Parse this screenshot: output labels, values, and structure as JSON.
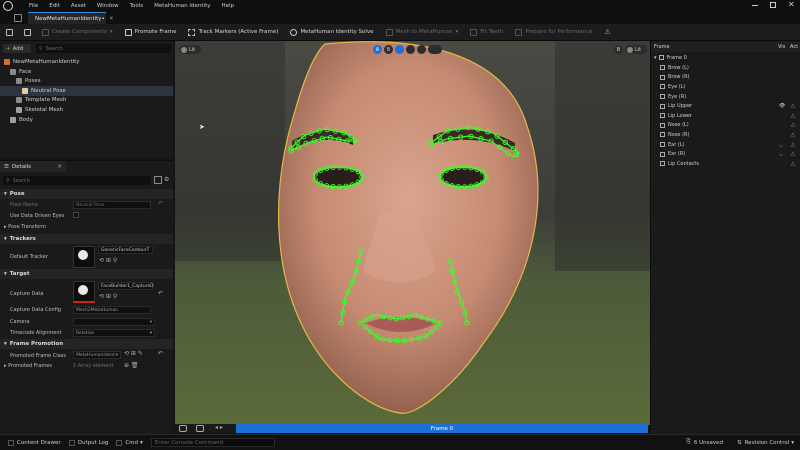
{
  "menu": [
    "File",
    "Edit",
    "Asset",
    "Window",
    "Tools",
    "MetaHuman Identity",
    "Help"
  ],
  "tab": {
    "label": "NewMetaHumanIdentity•"
  },
  "toolbar": {
    "create_components": "Create Components",
    "promote_frame": "Promote Frame",
    "track_markers": "Track Markers (Active Frame)",
    "identity_solve": "MetaHuman Identity Solve",
    "mesh_to_metahuman": "Mesh to MetaHuman",
    "fit_teeth": "Fit Teeth",
    "prepare_for_performance": "Prepare for Performance"
  },
  "outliner": {
    "add_label": "Add",
    "search_placeholder": "Search",
    "items": [
      {
        "label": "NewMetaHumanIdentity",
        "depth": 0
      },
      {
        "label": "Face",
        "depth": 1
      },
      {
        "label": "Poses",
        "depth": 2
      },
      {
        "label": "Neutral Pose",
        "depth": 3,
        "selected": true
      },
      {
        "label": "Template Mesh",
        "depth": 2
      },
      {
        "label": "Skeletal Mesh",
        "depth": 2
      },
      {
        "label": "Body",
        "depth": 1
      }
    ]
  },
  "details": {
    "title": "Details",
    "search_placeholder": "Search",
    "pose": {
      "header": "Pose",
      "pose_name_label": "Pose Name",
      "pose_name_value": "Neutral Pose",
      "use_data_driven_eyes": "Use Data Driven Eyes",
      "pose_transform": "Pose Transform"
    },
    "trackers": {
      "header": "Trackers",
      "default_tracker": "Default Tracker",
      "default_tracker_value": "GenericFaceContourT"
    },
    "target": {
      "header": "Target",
      "capture_data": "Capture Data",
      "capture_data_value": "FaceBuilder1_CaptureD",
      "capture_data_config": "Capture Data Config",
      "capture_data_config_value": "Mesh2MetaHuman",
      "camera": "Camera",
      "timecode_alignment": "Timecode Alignment",
      "timecode_alignment_value": "Relative"
    },
    "frame_promotion": {
      "header": "Frame Promotion",
      "promoted_frame_class": "Promoted Frame Class",
      "promoted_frame_class_value": "MetaHumanIdent",
      "promoted_frames": "Promoted Frames",
      "promoted_frames_value": "1 Array element"
    }
  },
  "viewport": {
    "left_badge": "Lit",
    "right_badge": "Lit",
    "view_a": "A",
    "view_b": "B",
    "frame_label": "Frame 0"
  },
  "frames_panel": {
    "header_frame": "Frame",
    "header_vis": "Vis",
    "header_act": "Act",
    "root": "Frame 0",
    "items": [
      "Brow (L)",
      "Brow (R)",
      "Eye (L)",
      "Eye (R)",
      "Lip Upper",
      "Lip Lower",
      "Nose (L)",
      "Nose (R)",
      "Ear (L)",
      "Ear (R)",
      "Lip Contacts"
    ]
  },
  "statusbar": {
    "content_drawer": "Content Drawer",
    "output_log": "Output Log",
    "cmd": "Cmd",
    "cmd_placeholder": "Enter Console Command",
    "unsaved": "6 Unsaved",
    "revision_control": "Revision Control"
  },
  "colors": {
    "accent": "#1d70d8",
    "marker_green": "#3cff2a",
    "face_outline": "#e3b84a",
    "panel_bg": "#1a1a1a"
  }
}
